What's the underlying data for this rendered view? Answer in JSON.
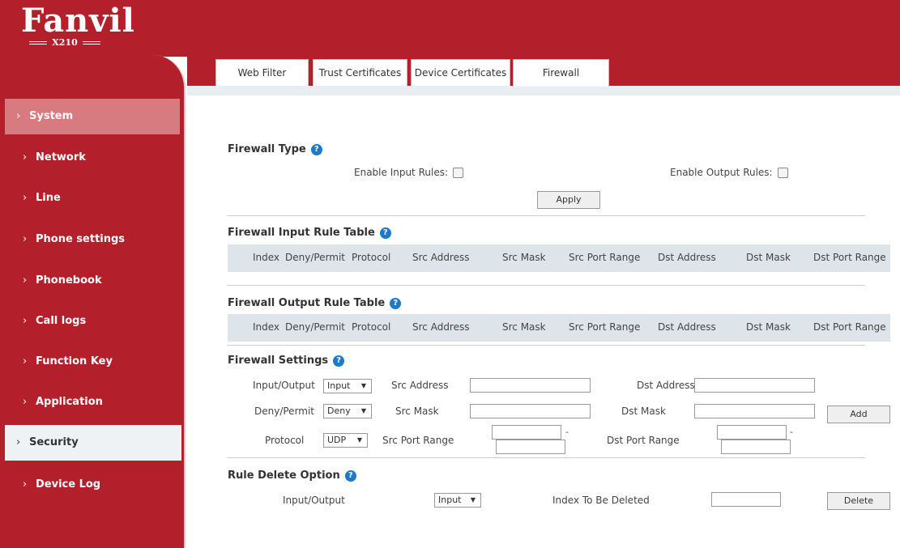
{
  "header": {
    "logo": "Fanvil",
    "model": "X210"
  },
  "tabs": [
    "Web Filter",
    "Trust Certificates",
    "Device Certificates",
    "Firewall"
  ],
  "sidebar": {
    "items": [
      "System",
      "Network",
      "Line",
      "Phone settings",
      "Phonebook",
      "Call logs",
      "Function Key",
      "Application",
      "Security",
      "Device Log"
    ],
    "chevron": "›"
  },
  "firewall_type": {
    "title": "Firewall Type",
    "enable_input_label": "Enable Input Rules:",
    "enable_output_label": "Enable Output Rules:",
    "apply": "Apply"
  },
  "input_table": {
    "title": "Firewall Input Rule Table",
    "columns": [
      "Index",
      "Deny/Permit",
      "Protocol",
      "Src Address",
      "Src Mask",
      "Src Port Range",
      "Dst Address",
      "Dst Mask",
      "Dst Port Range"
    ]
  },
  "output_table": {
    "title": "Firewall Output Rule Table",
    "columns": [
      "Index",
      "Deny/Permit",
      "Protocol",
      "Src Address",
      "Src Mask",
      "Src Port Range",
      "Dst Address",
      "Dst Mask",
      "Dst Port Range"
    ]
  },
  "settings": {
    "title": "Firewall Settings",
    "io_label": "Input/Output",
    "io_value": "Input",
    "dp_label": "Deny/Permit",
    "dp_value": "Deny",
    "protocol_label": "Protocol",
    "protocol_value": "UDP",
    "src_address": "Src Address",
    "src_mask": "Src Mask",
    "src_port_range": "Src Port Range",
    "dst_address": "Dst Address",
    "dst_mask": "Dst Mask",
    "dst_port_range": "Dst Port Range",
    "add": "Add",
    "dash": "-"
  },
  "delete": {
    "title": "Rule Delete Option",
    "io_label": "Input/Output",
    "io_value": "Input",
    "index_label": "Index To Be Deleted",
    "button": "Delete"
  },
  "icons": {
    "help": "?",
    "arrow": "▼"
  },
  "colors": {
    "brand_red": "#b3202b",
    "help_blue": "#1e79c7",
    "table_header": "#dde4ea"
  }
}
